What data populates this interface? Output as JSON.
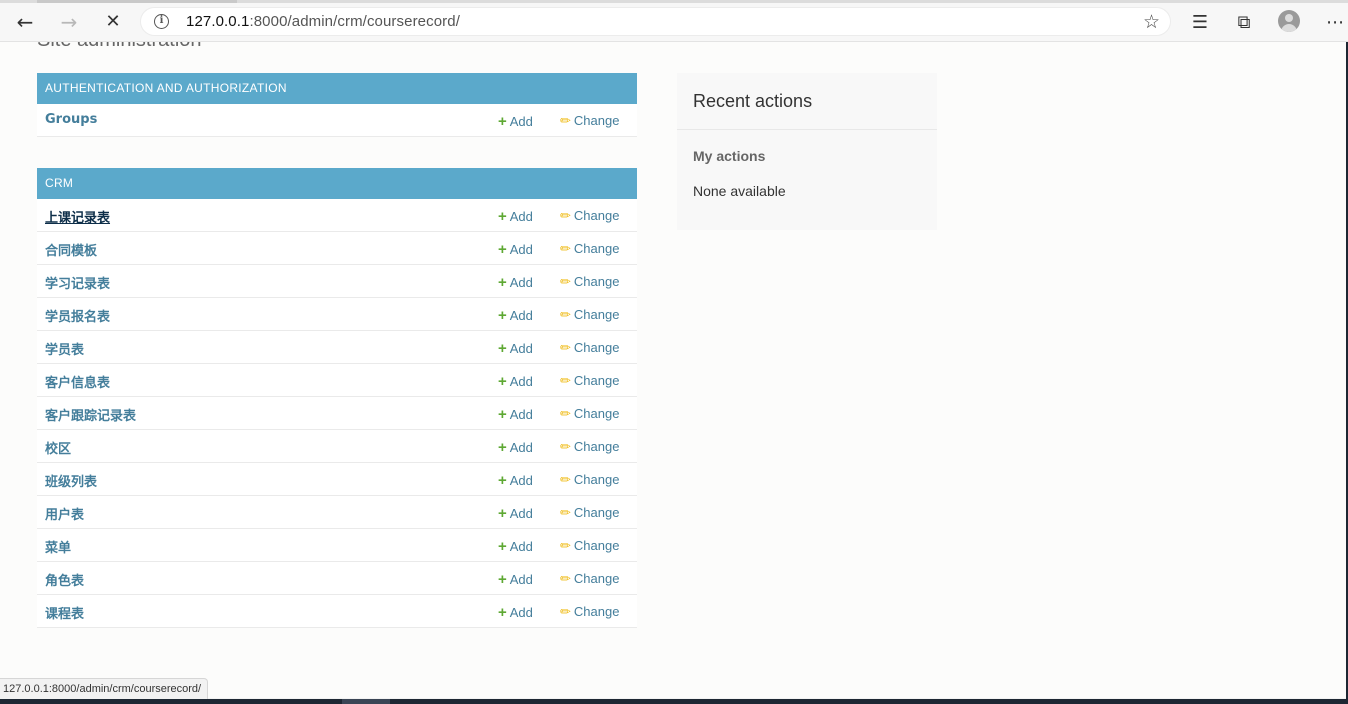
{
  "browser": {
    "url_host": "127.0.0.1",
    "url_rest": ":8000/admin/crm/courserecord/",
    "status_url": "127.0.0.1:8000/admin/crm/courserecord/"
  },
  "page": {
    "site_title": "Site administration"
  },
  "auth_module": {
    "caption": "AUTHENTICATION AND AUTHORIZATION",
    "rows": [
      {
        "name": "Groups",
        "add": "Add",
        "change": "Change"
      }
    ]
  },
  "crm_module": {
    "caption": "CRM",
    "rows": [
      {
        "name": "上课记录表",
        "add": "Add",
        "change": "Change"
      },
      {
        "name": "合同模板",
        "add": "Add",
        "change": "Change"
      },
      {
        "name": "学习记录表",
        "add": "Add",
        "change": "Change"
      },
      {
        "name": "学员报名表",
        "add": "Add",
        "change": "Change"
      },
      {
        "name": "学员表",
        "add": "Add",
        "change": "Change"
      },
      {
        "name": "客户信息表",
        "add": "Add",
        "change": "Change"
      },
      {
        "name": "客户跟踪记录表",
        "add": "Add",
        "change": "Change"
      },
      {
        "name": "校区",
        "add": "Add",
        "change": "Change"
      },
      {
        "name": "班级列表",
        "add": "Add",
        "change": "Change"
      },
      {
        "name": "用户表",
        "add": "Add",
        "change": "Change"
      },
      {
        "name": "菜单",
        "add": "Add",
        "change": "Change"
      },
      {
        "name": "角色表",
        "add": "Add",
        "change": "Change"
      },
      {
        "name": "课程表",
        "add": "Add",
        "change": "Change"
      }
    ]
  },
  "recent": {
    "title": "Recent actions",
    "subtitle": "My actions",
    "empty": "None available"
  },
  "icons": {
    "back": "back-arrow-icon",
    "forward": "forward-arrow-icon",
    "stop": "stop-loading-icon",
    "info": "site-info-icon",
    "favorite": "star-icon",
    "favorites": "favorites-icon",
    "collections": "collections-icon",
    "profile": "profile-icon",
    "menu": "more-icon"
  },
  "colors": {
    "caption_bg": "#5ba9cb",
    "link": "#447e9b",
    "add_plus": "#5ea833",
    "change_pencil": "#efb80b"
  }
}
